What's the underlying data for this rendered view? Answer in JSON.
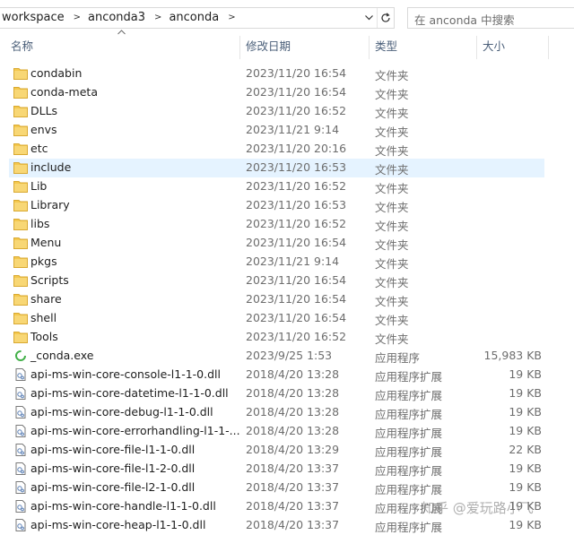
{
  "breadcrumb": [
    "workspace",
    "anconda3",
    "anconda"
  ],
  "search": {
    "placeholder": "在 anconda 中搜索"
  },
  "columns": {
    "name": "名称",
    "date": "修改日期",
    "type": "类型",
    "size": "大小"
  },
  "rows": [
    {
      "kind": "folder",
      "name": "condabin",
      "date": "2023/11/20 16:54",
      "type": "文件夹",
      "size": ""
    },
    {
      "kind": "folder",
      "name": "conda-meta",
      "date": "2023/11/20 16:54",
      "type": "文件夹",
      "size": ""
    },
    {
      "kind": "folder",
      "name": "DLLs",
      "date": "2023/11/20 16:52",
      "type": "文件夹",
      "size": ""
    },
    {
      "kind": "folder",
      "name": "envs",
      "date": "2023/11/21 9:14",
      "type": "文件夹",
      "size": ""
    },
    {
      "kind": "folder",
      "name": "etc",
      "date": "2023/11/20 20:16",
      "type": "文件夹",
      "size": ""
    },
    {
      "kind": "folder",
      "name": "include",
      "date": "2023/11/20 16:53",
      "type": "文件夹",
      "size": "",
      "selected": true
    },
    {
      "kind": "folder",
      "name": "Lib",
      "date": "2023/11/20 16:52",
      "type": "文件夹",
      "size": ""
    },
    {
      "kind": "folder",
      "name": "Library",
      "date": "2023/11/20 16:53",
      "type": "文件夹",
      "size": ""
    },
    {
      "kind": "folder",
      "name": "libs",
      "date": "2023/11/20 16:52",
      "type": "文件夹",
      "size": ""
    },
    {
      "kind": "folder",
      "name": "Menu",
      "date": "2023/11/20 16:54",
      "type": "文件夹",
      "size": ""
    },
    {
      "kind": "folder",
      "name": "pkgs",
      "date": "2023/11/21 9:14",
      "type": "文件夹",
      "size": ""
    },
    {
      "kind": "folder",
      "name": "Scripts",
      "date": "2023/11/20 16:54",
      "type": "文件夹",
      "size": ""
    },
    {
      "kind": "folder",
      "name": "share",
      "date": "2023/11/20 16:54",
      "type": "文件夹",
      "size": ""
    },
    {
      "kind": "folder",
      "name": "shell",
      "date": "2023/11/20 16:54",
      "type": "文件夹",
      "size": ""
    },
    {
      "kind": "folder",
      "name": "Tools",
      "date": "2023/11/20 16:52",
      "type": "文件夹",
      "size": ""
    },
    {
      "kind": "exe",
      "name": "_conda.exe",
      "date": "2023/9/25 1:53",
      "type": "应用程序",
      "size": "15,983 KB"
    },
    {
      "kind": "dll",
      "name": "api-ms-win-core-console-l1-1-0.dll",
      "date": "2018/4/20 13:28",
      "type": "应用程序扩展",
      "size": "19 KB"
    },
    {
      "kind": "dll",
      "name": "api-ms-win-core-datetime-l1-1-0.dll",
      "date": "2018/4/20 13:28",
      "type": "应用程序扩展",
      "size": "19 KB"
    },
    {
      "kind": "dll",
      "name": "api-ms-win-core-debug-l1-1-0.dll",
      "date": "2018/4/20 13:28",
      "type": "应用程序扩展",
      "size": "19 KB"
    },
    {
      "kind": "dll",
      "name": "api-ms-win-core-errorhandling-l1-1-...",
      "date": "2018/4/20 13:28",
      "type": "应用程序扩展",
      "size": "19 KB"
    },
    {
      "kind": "dll",
      "name": "api-ms-win-core-file-l1-1-0.dll",
      "date": "2018/4/20 13:29",
      "type": "应用程序扩展",
      "size": "22 KB"
    },
    {
      "kind": "dll",
      "name": "api-ms-win-core-file-l1-2-0.dll",
      "date": "2018/4/20 13:37",
      "type": "应用程序扩展",
      "size": "19 KB"
    },
    {
      "kind": "dll",
      "name": "api-ms-win-core-file-l2-1-0.dll",
      "date": "2018/4/20 13:37",
      "type": "应用程序扩展",
      "size": "19 KB"
    },
    {
      "kind": "dll",
      "name": "api-ms-win-core-handle-l1-1-0.dll",
      "date": "2018/4/20 13:37",
      "type": "应用程序扩展",
      "size": "19 KB"
    },
    {
      "kind": "dll",
      "name": "api-ms-win-core-heap-l1-1-0.dll",
      "date": "2018/4/20 13:37",
      "type": "应用程序扩展",
      "size": "19 KB"
    }
  ],
  "watermark": "知乎 @爱玩路小飞",
  "colors": {
    "folder": "#f4c84e",
    "selected_row": "#e5f3ff",
    "header_text": "#4c607a"
  }
}
